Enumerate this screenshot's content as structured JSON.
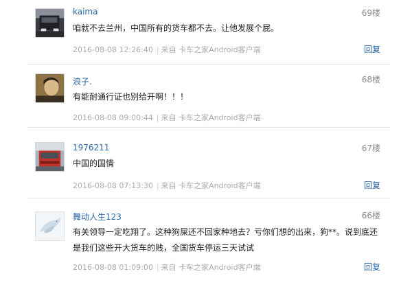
{
  "comments": [
    {
      "user": "kaima",
      "floor": "69楼",
      "content": "咱就不去兰州，中国所有的货车都不去。让他发展个屁。",
      "time": "2016-08-08 12:26:40",
      "source": "来自 卡车之家Android客户端",
      "reply": "回复",
      "avatar_icon": "truck-photo-avatar"
    },
    {
      "user": "浪子.",
      "floor": "68楼",
      "content": "有能耐通行证也别给开啊！！！",
      "time": "2016-08-08 09:00:44",
      "source": "来自 卡车之家Android客户端",
      "reply": "",
      "avatar_icon": "person-photo-avatar"
    },
    {
      "user": "1976211",
      "floor": "67楼",
      "content": "中国的国情",
      "time": "2016-08-08 07:13:30",
      "source": "来自 卡车之家Android客户端",
      "reply": "回复",
      "avatar_icon": "red-truck-avatar"
    },
    {
      "user": "舞动人生123",
      "floor": "66楼",
      "content": "有关领导一定吃翔了。这种狗屎还不回家种地去？亏你们想的出来，狗**。说到底还是我们这些开大货车的贱，全国货车停运三天试试",
      "time": "2016-08-08 01:09:00",
      "source": "来自 卡车之家Android客户端",
      "reply": "回复",
      "avatar_icon": "default-bird-avatar"
    }
  ]
}
